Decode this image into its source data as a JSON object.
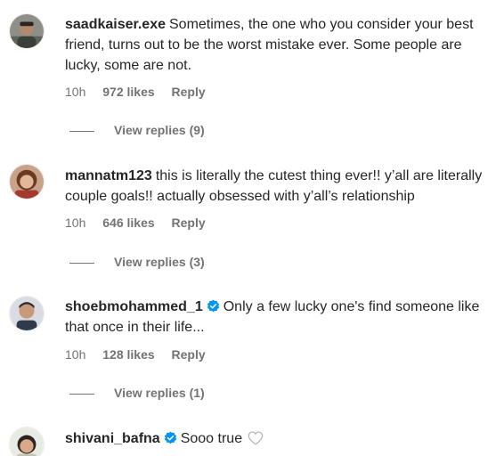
{
  "comments": [
    {
      "username": "saadkaiser.exe",
      "verified": false,
      "text": "Sometimes, the one who you consider your best friend, turns out to be the worst mistake ever. Some people are lucky, some are not.",
      "time": "10h",
      "likes": "972 likes",
      "reply_label": "Reply",
      "view_replies": "View replies (9)"
    },
    {
      "username": "mannatm123",
      "verified": false,
      "text": "this is literally the cutest thing ever!! y’all are literally couple goals!! actually obsessed with y’all’s relationship",
      "time": "10h",
      "likes": "646 likes",
      "reply_label": "Reply",
      "view_replies": "View replies (3)"
    },
    {
      "username": "shoebmohammed_1",
      "verified": true,
      "text": "Only a few lucky one's find someone like that once in their life...",
      "time": "10h",
      "likes": "128 likes",
      "reply_label": "Reply",
      "view_replies": "View replies (1)"
    },
    {
      "username": "shivani_bafna",
      "verified": true,
      "text": "Sooo true",
      "time": "",
      "likes": "",
      "reply_label": "",
      "view_replies": ""
    }
  ],
  "colors": {
    "text": "#262626",
    "secondary": "#737373",
    "verified": "#0095f6"
  },
  "icons": {
    "verified": "verified-badge-icon",
    "like": "heart-outline-icon"
  }
}
